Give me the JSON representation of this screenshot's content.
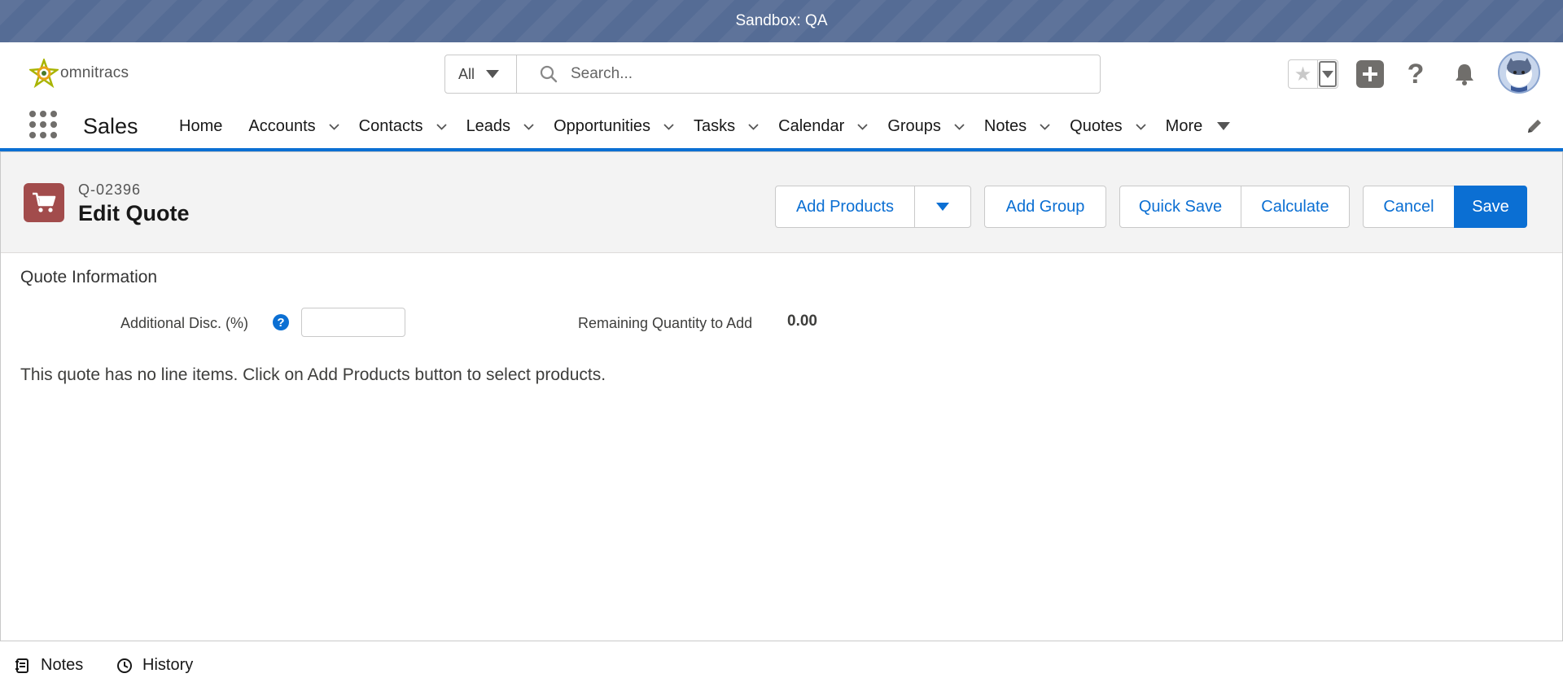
{
  "sandbox": {
    "label": "Sandbox: QA"
  },
  "header": {
    "logo_text": "omnitracs",
    "search_scope": "All",
    "search_placeholder": "Search...",
    "icons": [
      "favorite-star-icon",
      "add-icon",
      "help-icon",
      "notification-bell-icon",
      "avatar"
    ]
  },
  "nav": {
    "app_name": "Sales",
    "home": "Home",
    "items": [
      "Accounts",
      "Contacts",
      "Leads",
      "Opportunities",
      "Tasks",
      "Calendar",
      "Groups",
      "Notes",
      "Quotes"
    ],
    "more": "More"
  },
  "record": {
    "number": "Q-02396",
    "title": "Edit Quote",
    "buttons": {
      "add_products": "Add Products",
      "add_group": "Add Group",
      "quick_save": "Quick Save",
      "calculate": "Calculate",
      "cancel": "Cancel",
      "save": "Save"
    }
  },
  "section": {
    "title": "Quote Information",
    "additional_disc_label": "Additional Disc. (%)",
    "additional_disc_value": "",
    "remaining_label": "Remaining Quantity to Add",
    "remaining_value": "0.00",
    "empty_message": "This quote has no line items. Click on Add Products button to select products."
  },
  "utility": {
    "notes": "Notes",
    "history": "History"
  },
  "colors": {
    "brand_blue": "#0b6fd3",
    "sandbox_bar": "#556c95",
    "quote_icon": "#a24c4c"
  }
}
